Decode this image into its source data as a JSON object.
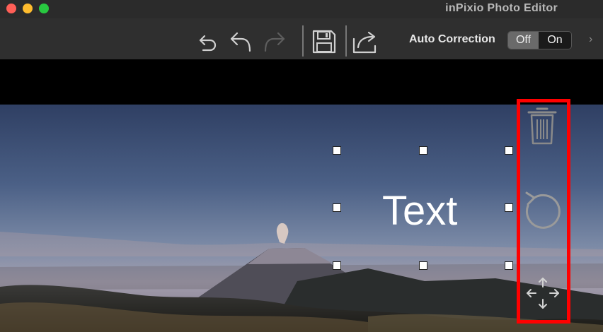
{
  "window": {
    "title": "inPixio Photo Editor",
    "traffic_lights": [
      "#ff5f57",
      "#febc2e",
      "#28c840"
    ]
  },
  "toolbar": {
    "icons": [
      "undo-all-icon",
      "undo-icon",
      "redo-icon",
      "save-icon",
      "share-icon"
    ],
    "auto_correction": {
      "label": "Auto Correction",
      "off_label": "Off",
      "on_label": "On",
      "selected": "Off"
    },
    "expand_icon": "›"
  },
  "canvas": {
    "text_layer": "Text",
    "side_tools": [
      "trash-icon",
      "rotate-icon",
      "move-icon"
    ],
    "highlight_color": "#ff0000"
  }
}
